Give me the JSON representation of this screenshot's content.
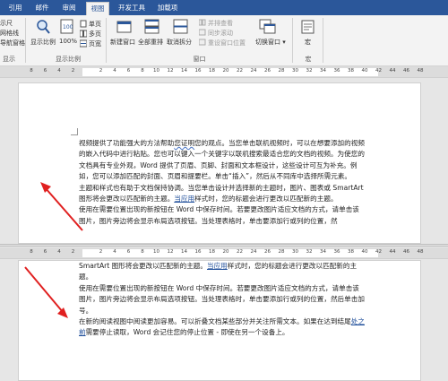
{
  "tabs": [
    "引用",
    "邮件",
    "审阅",
    "视图",
    "开发工具",
    "加载项"
  ],
  "active_tab": "视图",
  "ribbon": {
    "views_partial": [
      "示尺",
      "网格线",
      "导航窗格"
    ],
    "views_group_partial": "显示",
    "zoom_label": "显示比例",
    "zoom_100": "100%",
    "one_page": "单页",
    "multi_page": "多页",
    "page_width": "页宽",
    "zoom_group": "显示比例",
    "new_window": "新建窗口",
    "arrange_all": "全部重排",
    "split": "取消拆分",
    "side_by_side": "并排查看",
    "sync_scroll": "同步滚动",
    "reset_position": "重设窗口位置",
    "switch_window": "切换窗口",
    "window_group": "窗口",
    "macros": "宏",
    "macros_group": "宏"
  },
  "ruler_numbers": [
    "8",
    "6",
    "4",
    "2",
    "",
    "2",
    "4",
    "6",
    "8",
    "10",
    "12",
    "14",
    "16",
    "18",
    "20",
    "22",
    "24",
    "26",
    "28",
    "30",
    "32",
    "34",
    "36",
    "38",
    "40",
    "42",
    "44",
    "46",
    "48"
  ],
  "page1": {
    "p1_a": "视频提供了功能强大的方法帮助",
    "p1_u": "您证明",
    "p1_b": "您的观点。当您单击联机视频时，可以在想要添加的视频的嵌入代码中进行粘贴。您也可以键入一个关键字以联机搜索最适合您的文档的视频。为使您的文档具有专业外观，Word 提供了页眉、页脚、封面和文本框设计，这些设计可互为补充。例如，您可以添加匹配的封面、页眉和提要栏。单击“插入”，然后从不同库中选择所需元素。",
    "p2_a": "主题和样式也有助于文档保持协调。当您单击设计并选择新的主题时，图片、图表或 SmartArt 图形将会更改以匹配新的主题。",
    "p2_u": "当应用",
    "p2_b": "样式时，您的标题会进行更改以匹配新的主题。",
    "p3": "使用在需要位置出现的新按钮在 Word 中保存时间。若要更改图片适应文档的方式，请单击该图片，图片旁边将会显示布局选项按钮。当处理表格时，单击要添加行或列的位置，然"
  },
  "page2": {
    "l1_a": "SmartArt 图形将会更改以匹配新的主题。",
    "l1_u": "当应用",
    "l1_b": "样式时，您的标题会进行更改以匹配新的主题。",
    "p3": "使用在需要位置出现的新按钮在 Word 中保存时间。若要更改图片适应文档的方式，请单击该图片，图片旁边将会显示布局选项按钮。当处理表格时，单击要添加行或列的位置，然后单击加号。",
    "p4_a": "在新的阅读视图中阅读更加容易。可以折叠文档某些部分并关注所需文本。如果在达到结尾",
    "p4_u": "处之前",
    "p4_b": "需要停止读取，Word 会记住您的停止位置 - 即使在另一个设备上。"
  },
  "colors": {
    "ribbon_blue": "#2b579a",
    "arrow_red": "#e02020",
    "link_blue": "#1f4e9a"
  }
}
